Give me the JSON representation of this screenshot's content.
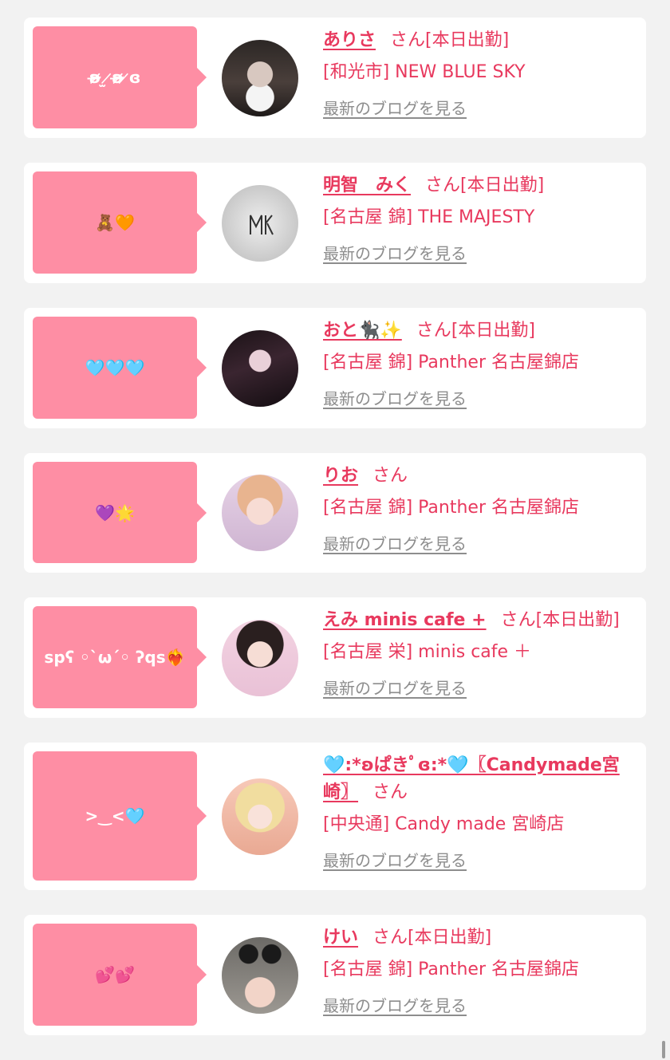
{
  "suffix_san": "さん",
  "blog_link_label": "最新のブログを見る",
  "colors": {
    "accent": "#e8395e",
    "bubble": "#fe8ea4",
    "link_gray": "#8d8d8d",
    "background": "#f2f2f2"
  },
  "cards": [
    {
      "comment": "ʚ̴̶̷̷ ̫ ̷ʚ̴̶̷̷ ̷ɞ",
      "name": "ありさ",
      "status": "[本日出勤]",
      "shop": "[和光市] NEW BLUE SKY",
      "avatar_icon": "avatar-photo"
    },
    {
      "comment": "🧸🧡",
      "name": "明智　みく",
      "status": "[本日出勤]",
      "shop": "[名古屋 錦] THE MAJESTY",
      "avatar_icon": "avatar-logo"
    },
    {
      "comment": "🩵🩵🩵",
      "name": "おと🐈‍⬛✨",
      "status": "[本日出勤]",
      "shop": "[名古屋 錦] Panther 名古屋錦店",
      "avatar_icon": "avatar-photo"
    },
    {
      "comment": "💜🌟",
      "name": "りお",
      "status": "",
      "shop": "[名古屋 錦] Panther 名古屋錦店",
      "avatar_icon": "avatar-photo"
    },
    {
      "comment": "spʕ ◦`ω´◦ ʔqs❤️‍🔥",
      "name": "えみ minis cafe +",
      "status": "[本日出勤]",
      "shop": "[名古屋 栄] minis cafe ＋",
      "avatar_icon": "avatar-photo"
    },
    {
      "comment": ">‿<🩵",
      "name": "🩵:*ʚぱきﾟɞ:*🩵〖Candymade宮崎〗",
      "status": "",
      "shop": "[中央通] Candy made 宮崎店",
      "avatar_icon": "avatar-photo"
    },
    {
      "comment": "💕💕",
      "name": "けい",
      "status": "[本日出勤]",
      "shop": "[名古屋 錦] Panther 名古屋錦店",
      "avatar_icon": "avatar-photo"
    }
  ]
}
